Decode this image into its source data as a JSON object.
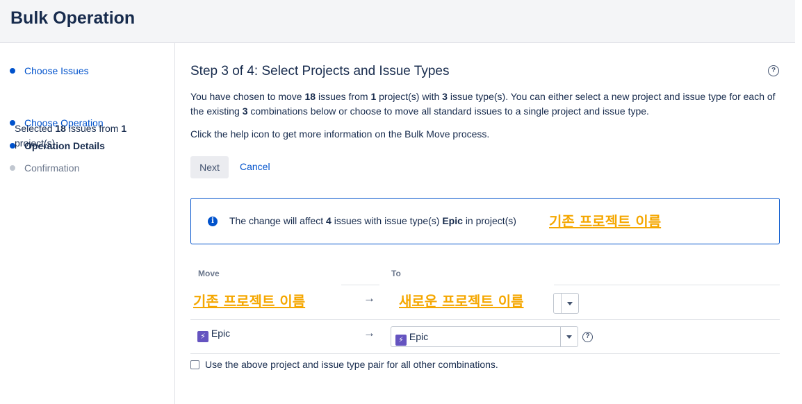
{
  "header": {
    "title": "Bulk Operation"
  },
  "sidebar": {
    "steps": [
      {
        "label": "Choose Issues",
        "state": "done"
      },
      {
        "label": "Choose Operation",
        "state": "done"
      },
      {
        "label": "Operation Details",
        "state": "current"
      },
      {
        "label": "Confirmation",
        "state": "pending"
      }
    ],
    "selected_prefix": "Selected",
    "selected_count": "18",
    "selected_middle": "issues from",
    "selected_projects": "1",
    "selected_suffix": "project(s)"
  },
  "main": {
    "title": "Step 3 of 4: Select Projects and Issue Types",
    "help_icon": "?",
    "intro": {
      "p1": "You have chosen to move",
      "count": "18",
      "p2": "issues from",
      "projects": "1",
      "p3": "project(s) with",
      "types": "3",
      "p4": "issue type(s). You can either select a new project and issue type for",
      "p5": "each of the existing",
      "combos": "3",
      "p6": "combinations below or choose to move all standard issues to a single project and issue type."
    },
    "help_text": "Click the help icon to get more information on the Bulk Move process.",
    "next_label": "Next",
    "cancel_label": "Cancel",
    "info": {
      "icon": "i",
      "t1": "The change will affect",
      "count": "4",
      "t2": "issues with issue type(s)",
      "type": "Epic",
      "t3": "in project(s)",
      "project": "기존 프로젝트 이름"
    },
    "table": {
      "col_move": "Move",
      "col_to": "To",
      "arrow": "→",
      "row1": {
        "from": "기존 프로젝트 이름",
        "to": "새로운 프로젝트 이름"
      },
      "row2": {
        "from_icon": "⚡",
        "from": "Epic",
        "to_icon": "⚡",
        "to": "Epic"
      }
    },
    "checkbox_label": "Use the above project and issue type pair for all other combinations."
  },
  "colors": {
    "link": "#0052cc",
    "annotation": "#f5a700",
    "epic": "#6554c0"
  }
}
